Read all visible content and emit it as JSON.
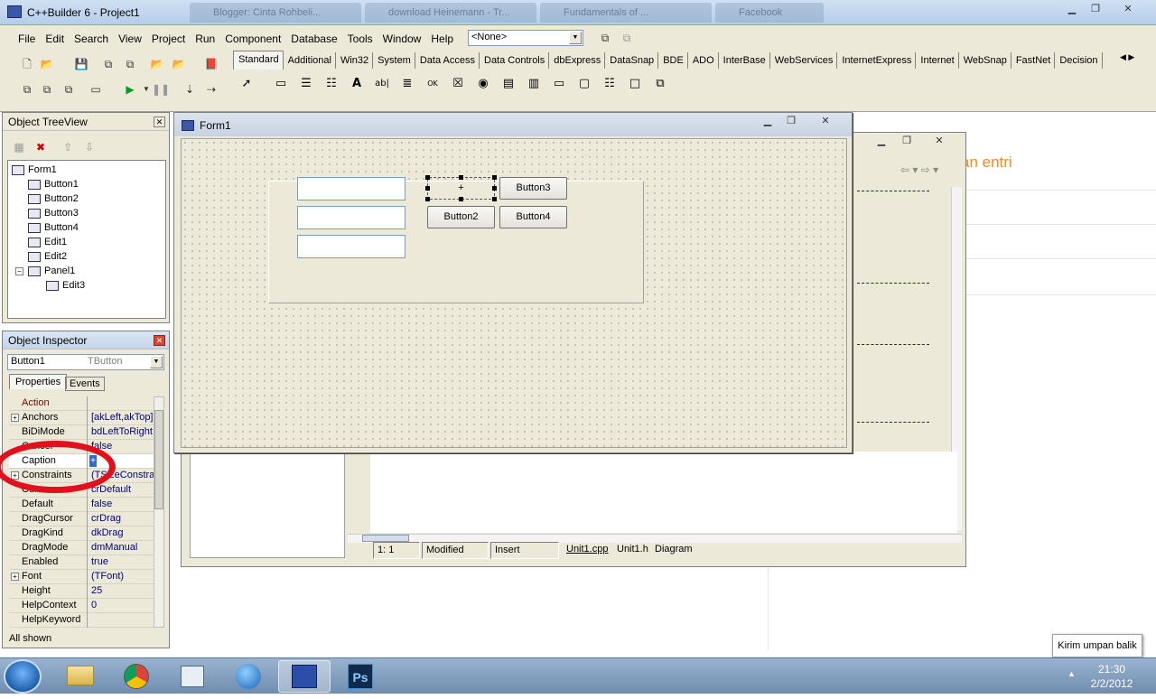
{
  "ide": {
    "title": "C++Builder 6 - Project1",
    "bg_tabs": [
      "Blogger: Cinta Rohbeli...",
      "download Heinemann - Tr...",
      "Fundamentals of ...",
      "Facebook"
    ],
    "menu": [
      "File",
      "Edit",
      "Search",
      "View",
      "Project",
      "Run",
      "Component",
      "Database",
      "Tools",
      "Window",
      "Help"
    ],
    "combo_value": "<None>",
    "palette_tabs": [
      "Standard",
      "Additional",
      "Win32",
      "System",
      "Data Access",
      "Data Controls",
      "dbExpress",
      "DataSnap",
      "BDE",
      "ADO",
      "InterBase",
      "WebServices",
      "InternetExpress",
      "Internet",
      "WebSnap",
      "FastNet",
      "Decision"
    ],
    "active_palette_tab": "Standard"
  },
  "treeview": {
    "title": "Object TreeView",
    "nodes": [
      {
        "label": "Form1",
        "depth": 0
      },
      {
        "label": "Button1",
        "depth": 1
      },
      {
        "label": "Button2",
        "depth": 1
      },
      {
        "label": "Button3",
        "depth": 1
      },
      {
        "label": "Button4",
        "depth": 1
      },
      {
        "label": "Edit1",
        "depth": 1
      },
      {
        "label": "Edit2",
        "depth": 1
      },
      {
        "label": "Panel1",
        "depth": 1
      },
      {
        "label": "Edit3",
        "depth": 2
      }
    ]
  },
  "inspector": {
    "title": "Object Inspector",
    "selected_object": "Button1",
    "selected_type": "TButton",
    "tabs": [
      "Properties",
      "Events"
    ],
    "properties": [
      {
        "name": "Action",
        "value": ""
      },
      {
        "name": "Anchors",
        "value": "[akLeft,akTop]"
      },
      {
        "name": "BiDiMode",
        "value": "bdLeftToRight"
      },
      {
        "name": "Cancel",
        "value": "false"
      },
      {
        "name": "Caption",
        "value": ""
      },
      {
        "name": "Constraints",
        "value": "(TSizeConstra"
      },
      {
        "name": "Cursor",
        "value": "crDefault"
      },
      {
        "name": "Default",
        "value": "false"
      },
      {
        "name": "DragCursor",
        "value": "crDrag"
      },
      {
        "name": "DragKind",
        "value": "dkDrag"
      },
      {
        "name": "DragMode",
        "value": "dmManual"
      },
      {
        "name": "Enabled",
        "value": "true"
      },
      {
        "name": "Font",
        "value": "(TFont)"
      },
      {
        "name": "Height",
        "value": "25"
      },
      {
        "name": "HelpContext",
        "value": "0"
      },
      {
        "name": "HelpKeyword",
        "value": ""
      }
    ],
    "footer": "All shown"
  },
  "form1": {
    "title": "Form1",
    "buttons": {
      "b2": "Button2",
      "b3": "Button3",
      "b4": "Button4",
      "b1_caption": "+"
    }
  },
  "editor": {
    "status": {
      "pos": "1:   1",
      "modified": "Modified",
      "mode": "Insert"
    },
    "tabs": [
      "Unit1.cpp",
      "Unit1.h",
      "Diagram"
    ]
  },
  "browser_fragment": "an entri",
  "taskbar": {
    "tooltip": "Kirim umpan balik",
    "time": "21:30",
    "date": "2/2/2012",
    "apps": [
      "explorer",
      "chrome",
      "notes",
      "globe",
      "cppbuilder",
      "photoshop"
    ],
    "ps_label": "Ps"
  },
  "colors": {
    "highlight": "#e0101c",
    "value_text": "#000080",
    "accent_orange": "#f08a24"
  }
}
